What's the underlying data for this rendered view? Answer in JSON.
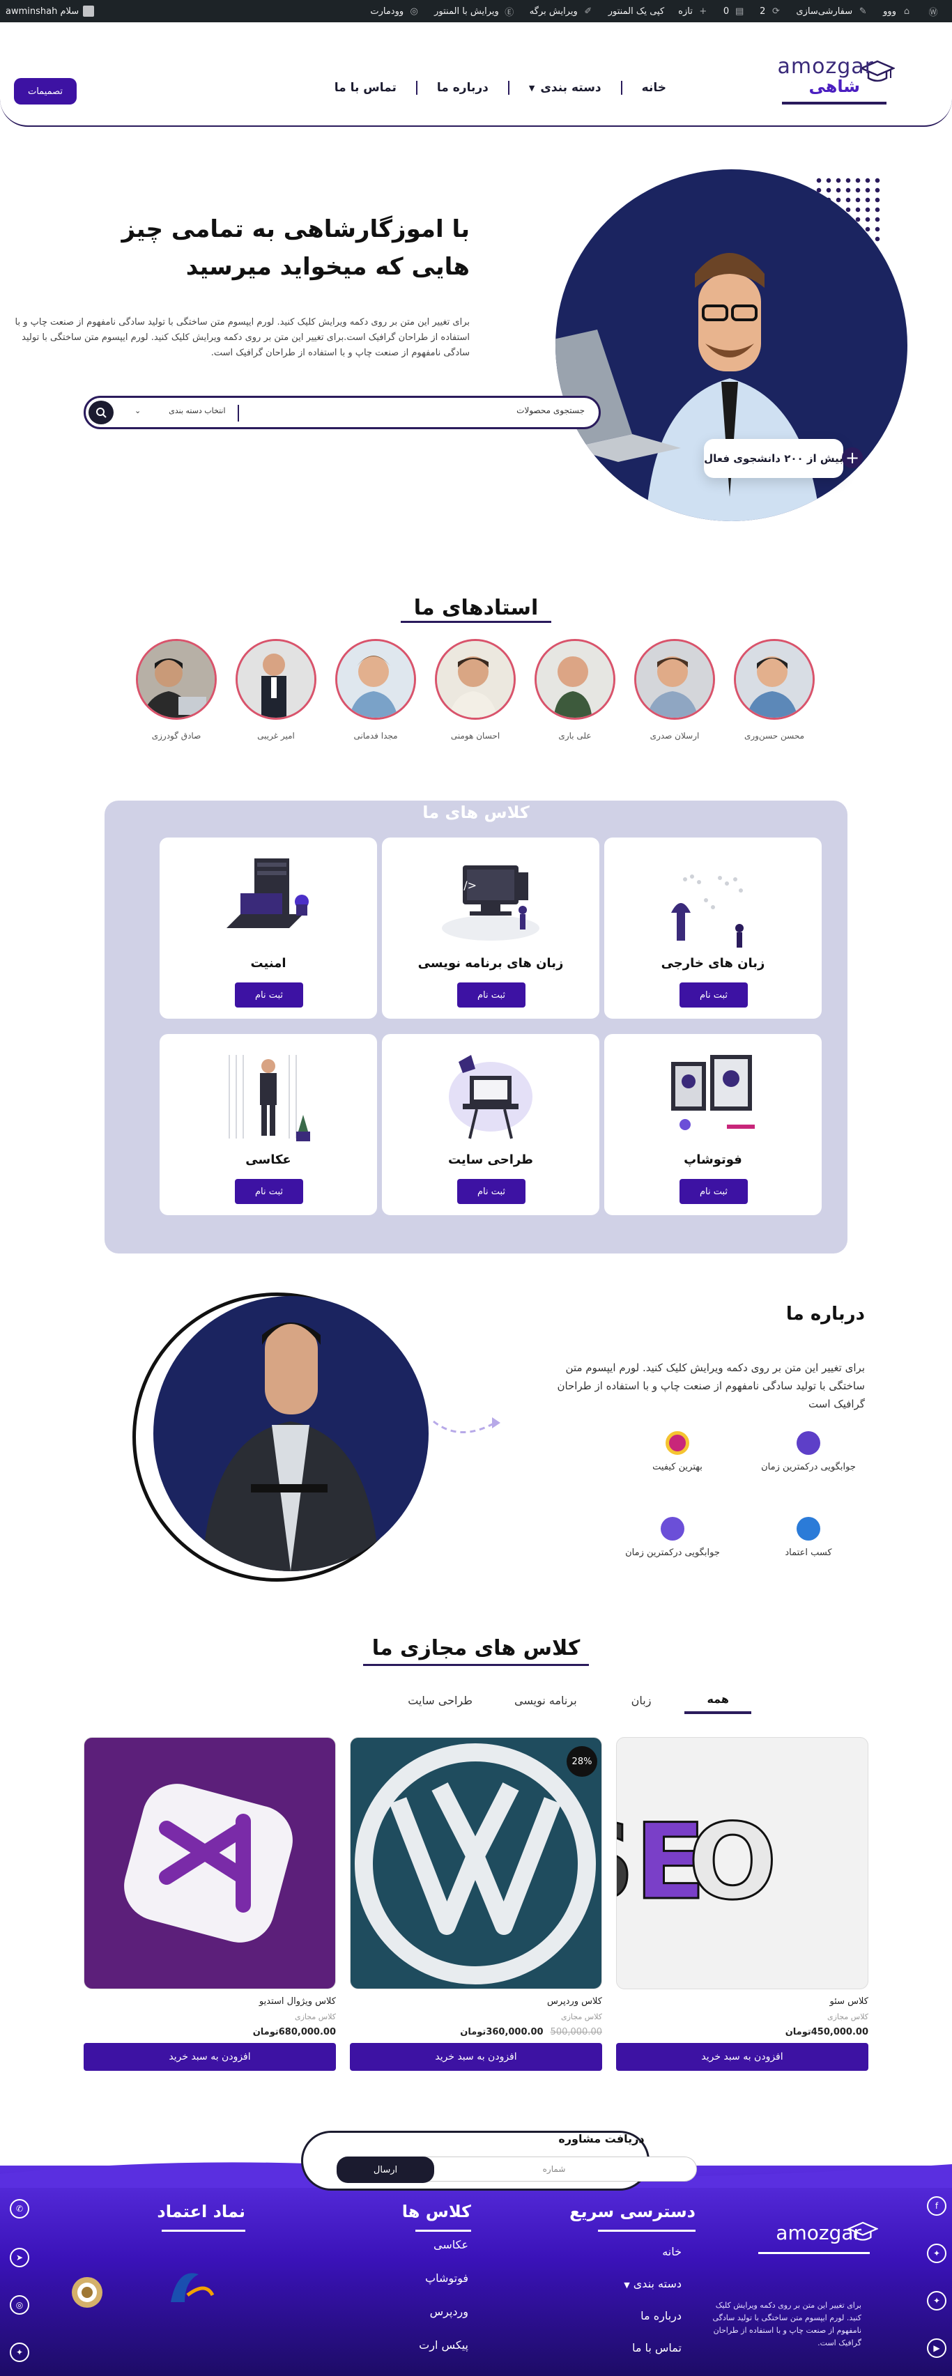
{
  "adminbar": {
    "site_name": "سفارشی‌سازی",
    "customize": "سفارشی‌سازی",
    "updates": "2",
    "comments": "0",
    "new": "تازه",
    "edit_with": "کپی یک المنتور",
    "edit_page": "ویرایش برگه",
    "edit_elementor": "ویرایش با المنتور",
    "woodmart": "وودمارت",
    "greeting": "سلام awminshah",
    "home_glyph": "ووو"
  },
  "header": {
    "logo_en": "amozgar",
    "logo_fa": "شاهی",
    "nav": [
      {
        "label": "خانه"
      },
      {
        "label": "دسته بندی"
      },
      {
        "label": "درباره ما"
      },
      {
        "label": "تماس با ما"
      }
    ],
    "consult_button": "تصمیمات"
  },
  "hero": {
    "title": "با اموزگارشاهی به تمامی چیز هایی که میخواید میرسید",
    "description": "برای تغییر این متن بر روی دکمه ویرایش کلیک کنید. لورم ایپسوم متن ساختگی با تولید سادگی نامفهوم از صنعت چاپ و با استفاده از طراحان گرافیک است.برای تغییر این متن بر روی دکمه ویرایش کلیک کنید. لورم ایپسوم متن ساختگی با تولید سادگی نامفهوم از صنعت چاپ و با استفاده از طراحان گرافیک است.",
    "search_placeholder": "جستجوی محصولات",
    "category_label": "انتخاب دسته بندی",
    "badge": "بیش از ۲۰۰ دانشجوی فعال",
    "badge_plus": "+"
  },
  "teachers": {
    "title": "استادهای ما",
    "items": [
      {
        "name": "محسن حسن‌وری"
      },
      {
        "name": "ارسلان صدری"
      },
      {
        "name": "علی باری"
      },
      {
        "name": "احسان هومنی"
      },
      {
        "name": "مجدا فدمانی"
      },
      {
        "name": "امیر غریبی"
      },
      {
        "name": "صادق گودرزی"
      }
    ]
  },
  "classes": {
    "title": "کلاس های ما",
    "register_label": "ثبت نام",
    "items": [
      {
        "title": "زبان های خارجی"
      },
      {
        "title": "زبان های برنامه نویسی"
      },
      {
        "title": "امنیت"
      },
      {
        "title": "فوتوشاپ"
      },
      {
        "title": "طراحی سایت"
      },
      {
        "title": "عکاسی"
      }
    ]
  },
  "about": {
    "title": "درباره ما",
    "text": "برای تغییر این متن بر روی دکمه ویرایش کلیک کنید. لورم ایپسوم متن ساختگی با تولید سادگی نامفهوم از صنعت چاپ و با استفاده از طراحان گرافیک است",
    "features": [
      {
        "label": "جوابگویی درکمترین زمان",
        "color": "#5d3fc8"
      },
      {
        "label": "بهترین کیفیت",
        "color": "#c8267a"
      },
      {
        "label": "کسب اعتماد",
        "color": "#2b7bd8"
      },
      {
        "label": "جوابگویی درکمترین زمان",
        "color": "#6b4fd8"
      }
    ]
  },
  "products": {
    "title": "کلاس های مجازی ما",
    "tabs": [
      {
        "label": "همه"
      },
      {
        "label": "زبان"
      },
      {
        "label": "برنامه نویسی"
      },
      {
        "label": "طراحی سایت"
      }
    ],
    "add_to_cart": "افزودن به سبد خرید",
    "items": [
      {
        "name": "کلاس سئو",
        "category": "کلاس مجازی",
        "price": "450,000.00",
        "currency": "تومان",
        "old_price": "",
        "badge": ""
      },
      {
        "name": "کلاس وردپرس",
        "category": "کلاس مجازی",
        "price": "360,000.00",
        "currency": "تومان",
        "old_price": "500,000.00",
        "badge": "28%"
      },
      {
        "name": "کلاس ویژوال استدیو",
        "category": "کلاس مجازی",
        "price": "680,000.00",
        "currency": "تومان",
        "old_price": "",
        "badge": ""
      }
    ]
  },
  "consult": {
    "label": "دریافت مشاوره",
    "input_placeholder": "شماره",
    "send": "ارسال"
  },
  "footer": {
    "logo_en": "amozgar",
    "description": "برای تغییر این متن بر روی دکمه ویرایش کلیک کنید. لورم ایپسوم متن ساختگی با تولید سادگی نامفهوم از صنعت چاپ و با استفاده از طراحان گرافیک است.",
    "quick_access": {
      "title": "دسترسی سریع",
      "links": [
        {
          "label": "خانه"
        },
        {
          "label": "دسته بندی"
        },
        {
          "label": "درباره ما"
        },
        {
          "label": "تماس با ما"
        }
      ]
    },
    "classes": {
      "title": "کلاس ها",
      "links": [
        {
          "label": "عکاسی"
        },
        {
          "label": "فوتوشاپ"
        },
        {
          "label": "وردپرس"
        },
        {
          "label": "پیکس ارت"
        }
      ]
    },
    "trust": {
      "title": "نماد اعتماد"
    },
    "social_left": [
      "whatsapp",
      "telegram",
      "instagram",
      "twitter"
    ],
    "social_right": [
      "facebook",
      "twitter",
      "twitter",
      "youtube"
    ]
  }
}
